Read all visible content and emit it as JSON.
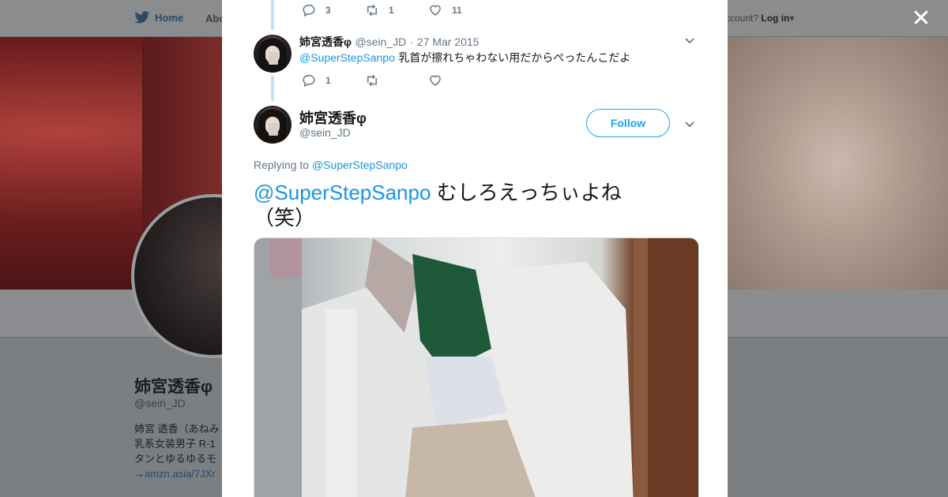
{
  "background": {
    "nav": {
      "home_label": "Home",
      "about_label": "Abo",
      "login_prefix": "ccount?",
      "login_label": "Log in"
    },
    "profile": {
      "name": "姉宮透香φ",
      "handle": "@sein_JD",
      "bio_line1": "姉宮 透香（あねみ",
      "bio_line2": "乳系女装男子 R-1",
      "bio_line3": "タンとゆるゆるモ",
      "bio_link": "amzn.asia/7JXr",
      "bio_link_prefix": "→"
    }
  },
  "modal": {
    "prev_actions": {
      "reply_count": "3",
      "retweet_count": "1",
      "like_count": "11"
    },
    "reply_tweet": {
      "name": "姉宮透香φ",
      "handle": "@sein_JD",
      "separator": "·",
      "date": "27 Mar 2015",
      "mention": "@SuperStepSanpo",
      "text": "乳首が擦れちゃわない用だからぺったんこだよ",
      "reply_count": "1",
      "retweet_count": "",
      "like_count": ""
    },
    "main_tweet": {
      "name": "姉宮透香φ",
      "handle": "@sein_JD",
      "follow_label": "Follow",
      "replying_prefix": "Replying to",
      "replying_to": "@SuperStepSanpo",
      "mention": "@SuperStepSanpo",
      "text": "むしろえっちぃよね（笑）"
    }
  },
  "colors": {
    "accent": "#1da1f2",
    "link": "#1b95e0",
    "muted": "#657786",
    "thread_line": "#bfe4f6"
  },
  "icons": [
    "twitter-bird-icon",
    "close-icon",
    "reply-icon",
    "retweet-icon",
    "like-icon",
    "chevron-down-icon"
  ]
}
